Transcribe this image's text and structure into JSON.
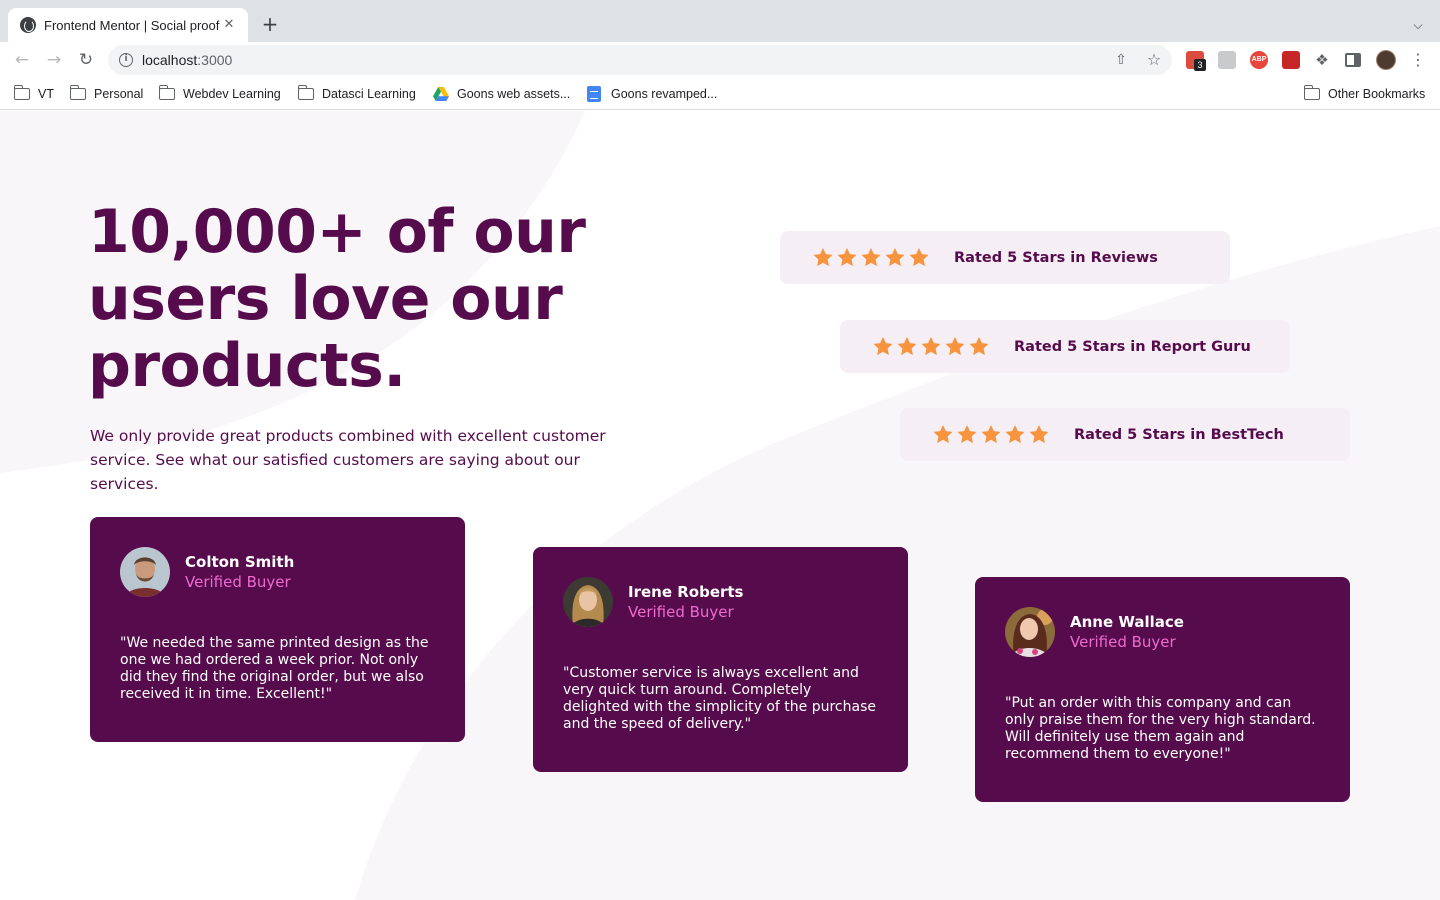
{
  "browser": {
    "tab_title": "Frontend Mentor | Social proof",
    "tab_close": "✕",
    "new_tab": "+",
    "url_host": "localhost",
    "url_port": ":3000",
    "extension_badge": "3",
    "abp_label": "ABP",
    "bookmarks": [
      {
        "label": "VT",
        "icon": "folder-icon"
      },
      {
        "label": "Personal",
        "icon": "folder-icon"
      },
      {
        "label": "Webdev Learning",
        "icon": "folder-icon"
      },
      {
        "label": "Datasci Learning",
        "icon": "folder-icon"
      },
      {
        "label": "Goons web assets...",
        "icon": "drive-icon"
      },
      {
        "label": "Goons revamped...",
        "icon": "docs-icon"
      }
    ],
    "other_bookmarks": "Other Bookmarks"
  },
  "hero": {
    "headline": "10,000+ of our users love our products.",
    "intro": "We only provide great products combined with excellent customer service. See what our satisfied customers are saying about our services."
  },
  "ratings": [
    {
      "text": "Rated 5 Stars in Reviews",
      "stars": 5
    },
    {
      "text": "Rated 5 Stars in Report Guru",
      "stars": 5
    },
    {
      "text": "Rated 5 Stars in BestTech",
      "stars": 5
    }
  ],
  "testimonials": [
    {
      "name": "Colton Smith",
      "role": "Verified Buyer",
      "quote": "\"We needed the same printed design as the one we had ordered a week prior. Not only did they find the original order, but we also received it in time. Excellent!\""
    },
    {
      "name": "Irene Roberts",
      "role": "Verified Buyer",
      "quote": "\"Customer service is always excellent and very quick turn around. Completely delighted with the simplicity of the purchase and the speed of delivery.\""
    },
    {
      "name": "Anne Wallace",
      "role": "Verified Buyer",
      "quote": "\"Put an order with this company and can only praise them for the very high standard. Will definitely use them again and recommend them to everyone!\""
    }
  ],
  "colors": {
    "brand_purple": "#560c4c",
    "light_pink_bg": "#f6eef5",
    "accent_pink": "#ee6acf",
    "star_orange": "#f7943d"
  }
}
